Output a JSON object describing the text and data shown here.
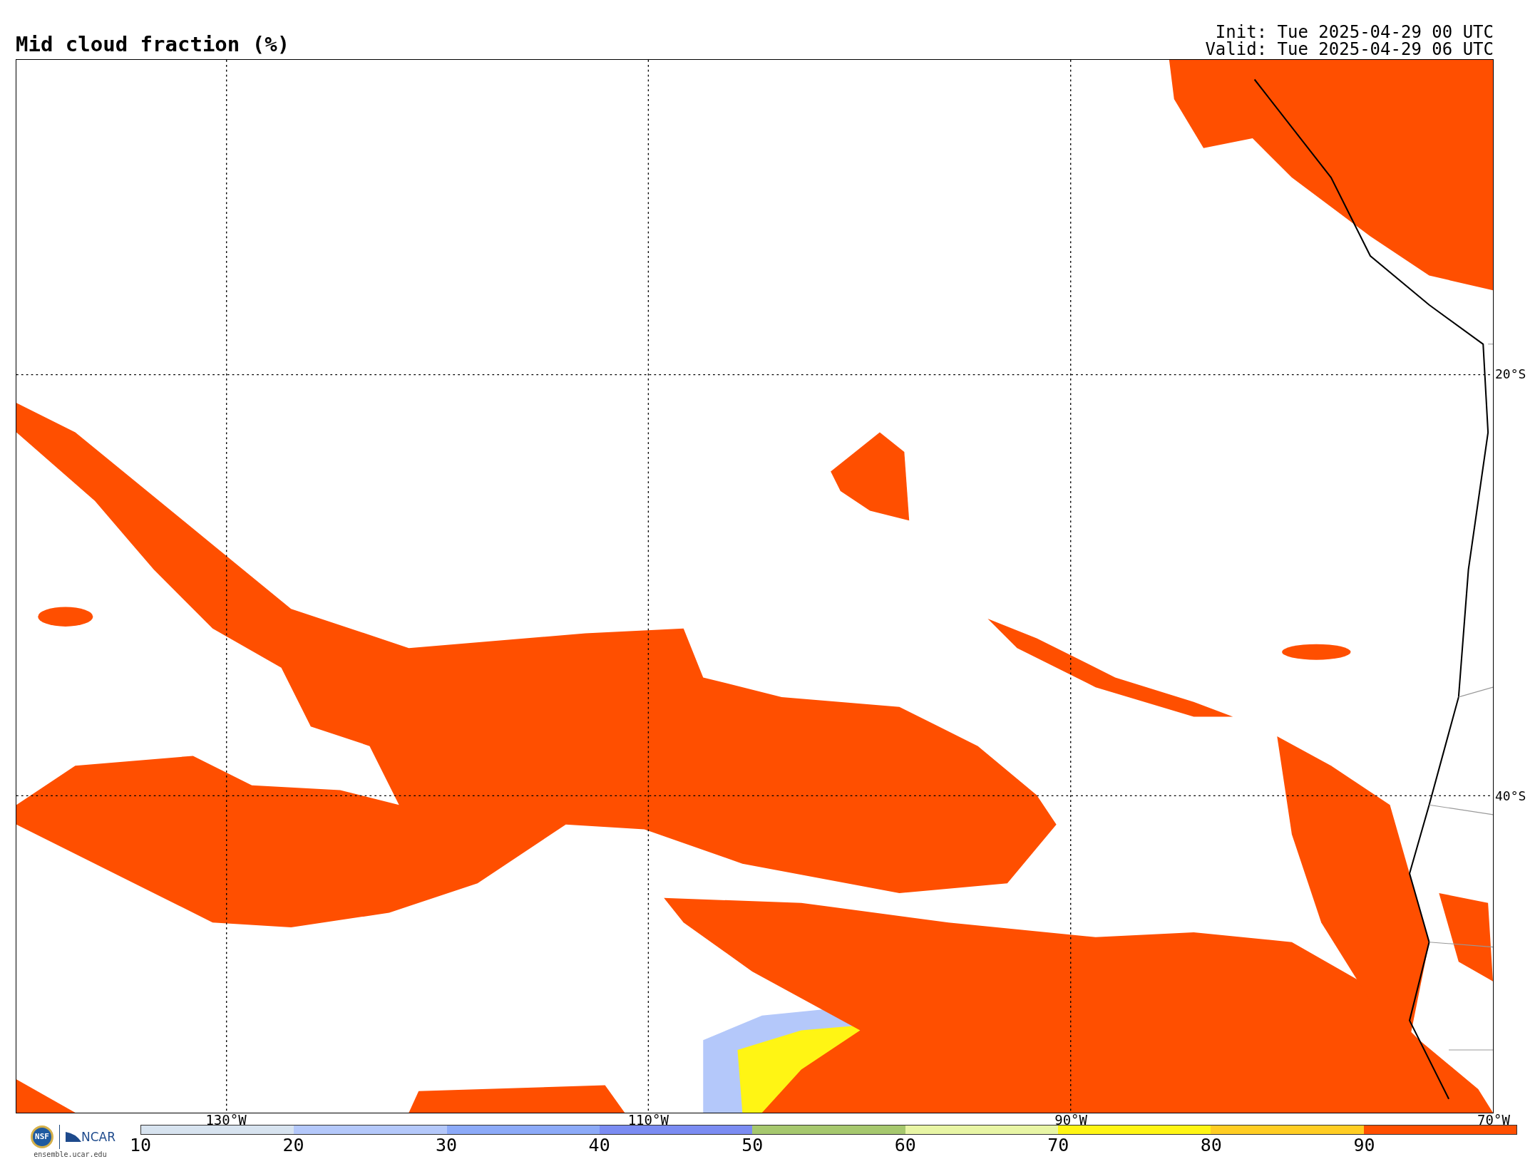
{
  "title": "Mid cloud fraction (%)",
  "init": "Init: Tue 2025-04-29 00 UTC",
  "valid": "Valid: Tue 2025-04-29 06 UTC",
  "map": {
    "longitude_labels": [
      "130°W",
      "110°W",
      "90°W",
      "70°W"
    ],
    "latitude_labels": [
      "20°S",
      "40°S"
    ]
  },
  "logo": {
    "nsf": "NSF",
    "ncar": "NCAR",
    "site": "ensemble.ucar.edu"
  },
  "colorbar": {
    "segments": [
      {
        "color": "#d7e3ef"
      },
      {
        "color": "#b4c8fa"
      },
      {
        "color": "#8caaf8"
      },
      {
        "color": "#7b8cf2"
      },
      {
        "color": "#a6c86e"
      },
      {
        "color": "#e8f5a5"
      },
      {
        "color": "#fff514"
      },
      {
        "color": "#ffcd23"
      },
      {
        "color": "#ff4f00"
      }
    ],
    "ticks": [
      "10",
      "20",
      "30",
      "40",
      "50",
      "60",
      "70",
      "80",
      "90"
    ]
  }
}
